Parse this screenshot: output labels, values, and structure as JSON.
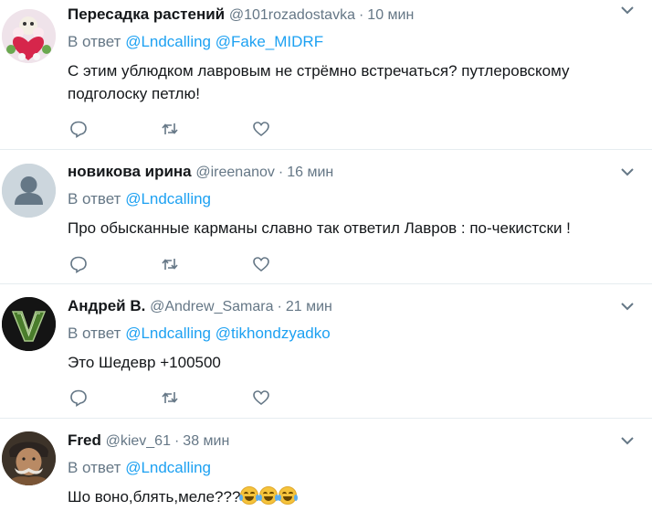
{
  "tweets": [
    {
      "fullname": "Пересадка растений",
      "screen_name": "@101rozadostavka",
      "dot": "·",
      "time": "10 мин",
      "reply_prefix": "В ответ",
      "mentions": [
        "@Lndcalling",
        "@Fake_MIDRF"
      ],
      "text_lines": [
        "С этим ублюдком лавровым не стрёмно встречаться? путлеровскому",
        "подголоску петлю!"
      ],
      "avatar_icon": "flower-bouquet-avatar"
    },
    {
      "fullname": "новикова ирина",
      "screen_name": "@ireenanov",
      "dot": "·",
      "time": "16 мин",
      "reply_prefix": "В ответ",
      "mentions": [
        "@Lndcalling"
      ],
      "text_lines": [
        "Про обысканные карманы славно так ответил Лавров :  по-чекистски !"
      ],
      "avatar_icon": "default-user-avatar"
    },
    {
      "fullname": "Андрей В.",
      "screen_name": "@Andrew_Samara",
      "dot": "·",
      "time": "21 мин",
      "reply_prefix": "В ответ",
      "mentions": [
        "@Lndcalling",
        "@tikhondzyadko"
      ],
      "text_lines": [
        "Это Шедевр +100500"
      ],
      "avatar_icon": "gta-v-logo-avatar"
    },
    {
      "fullname": "Fred",
      "screen_name": "@kiev_61",
      "dot": "·",
      "time": "38 мин",
      "reply_prefix": "В ответ",
      "mentions": [
        "@Lndcalling"
      ],
      "text_lines": [
        "Шо воно,блять,меле???"
      ],
      "emoji": [
        "face-with-tears-of-joy",
        "face-with-tears-of-joy",
        "face-with-tears-of-joy"
      ],
      "avatar_icon": "cossack-portrait-avatar"
    }
  ],
  "colors": {
    "text": "#14171a",
    "secondary": "#657786",
    "link": "#1da1f2",
    "divider": "#e6ecf0"
  }
}
